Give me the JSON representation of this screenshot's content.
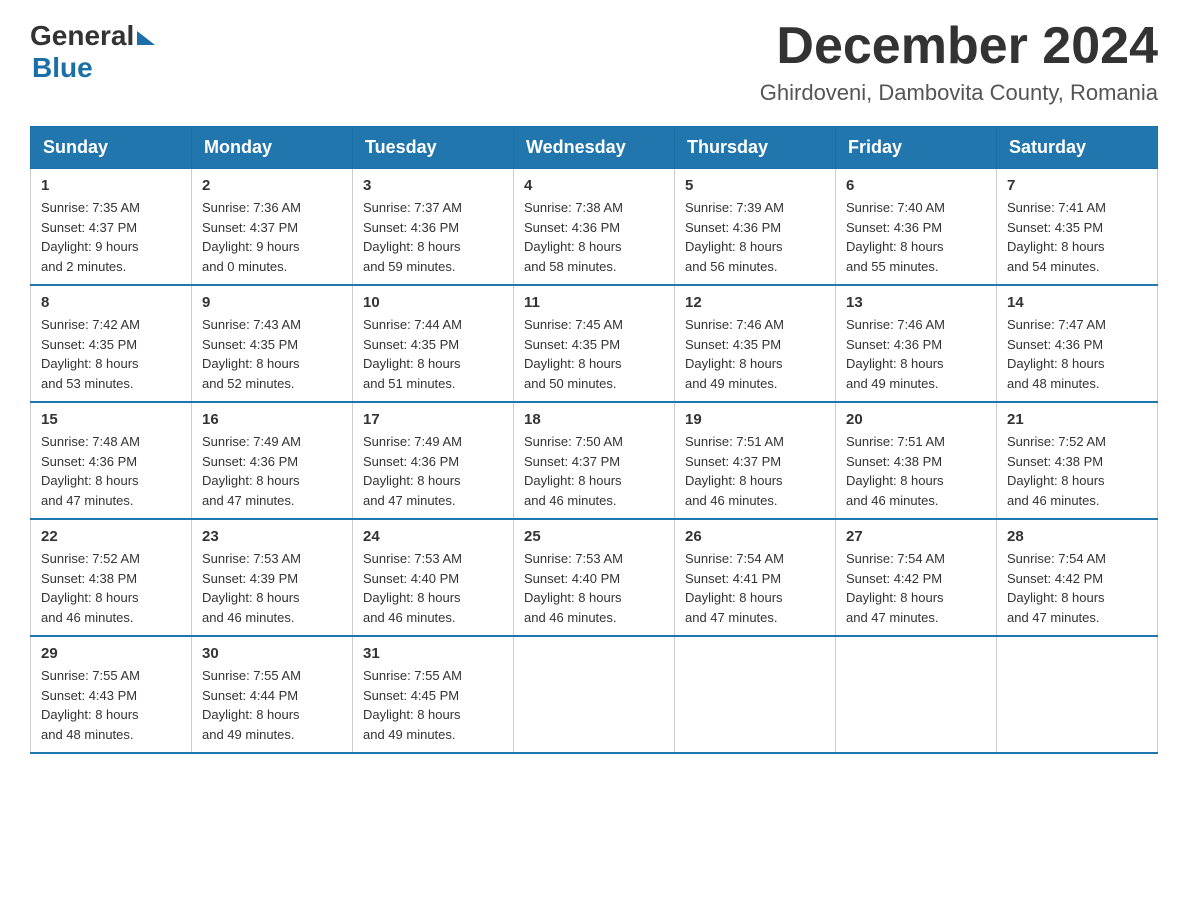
{
  "logo": {
    "general": "General",
    "blue": "Blue"
  },
  "header": {
    "title": "December 2024",
    "location": "Ghirdoveni, Dambovita County, Romania"
  },
  "days_of_week": [
    "Sunday",
    "Monday",
    "Tuesday",
    "Wednesday",
    "Thursday",
    "Friday",
    "Saturday"
  ],
  "weeks": [
    [
      {
        "day": "1",
        "sunrise": "7:35 AM",
        "sunset": "4:37 PM",
        "daylight": "9 hours and 2 minutes."
      },
      {
        "day": "2",
        "sunrise": "7:36 AM",
        "sunset": "4:37 PM",
        "daylight": "9 hours and 0 minutes."
      },
      {
        "day": "3",
        "sunrise": "7:37 AM",
        "sunset": "4:36 PM",
        "daylight": "8 hours and 59 minutes."
      },
      {
        "day": "4",
        "sunrise": "7:38 AM",
        "sunset": "4:36 PM",
        "daylight": "8 hours and 58 minutes."
      },
      {
        "day": "5",
        "sunrise": "7:39 AM",
        "sunset": "4:36 PM",
        "daylight": "8 hours and 56 minutes."
      },
      {
        "day": "6",
        "sunrise": "7:40 AM",
        "sunset": "4:36 PM",
        "daylight": "8 hours and 55 minutes."
      },
      {
        "day": "7",
        "sunrise": "7:41 AM",
        "sunset": "4:35 PM",
        "daylight": "8 hours and 54 minutes."
      }
    ],
    [
      {
        "day": "8",
        "sunrise": "7:42 AM",
        "sunset": "4:35 PM",
        "daylight": "8 hours and 53 minutes."
      },
      {
        "day": "9",
        "sunrise": "7:43 AM",
        "sunset": "4:35 PM",
        "daylight": "8 hours and 52 minutes."
      },
      {
        "day": "10",
        "sunrise": "7:44 AM",
        "sunset": "4:35 PM",
        "daylight": "8 hours and 51 minutes."
      },
      {
        "day": "11",
        "sunrise": "7:45 AM",
        "sunset": "4:35 PM",
        "daylight": "8 hours and 50 minutes."
      },
      {
        "day": "12",
        "sunrise": "7:46 AM",
        "sunset": "4:35 PM",
        "daylight": "8 hours and 49 minutes."
      },
      {
        "day": "13",
        "sunrise": "7:46 AM",
        "sunset": "4:36 PM",
        "daylight": "8 hours and 49 minutes."
      },
      {
        "day": "14",
        "sunrise": "7:47 AM",
        "sunset": "4:36 PM",
        "daylight": "8 hours and 48 minutes."
      }
    ],
    [
      {
        "day": "15",
        "sunrise": "7:48 AM",
        "sunset": "4:36 PM",
        "daylight": "8 hours and 47 minutes."
      },
      {
        "day": "16",
        "sunrise": "7:49 AM",
        "sunset": "4:36 PM",
        "daylight": "8 hours and 47 minutes."
      },
      {
        "day": "17",
        "sunrise": "7:49 AM",
        "sunset": "4:36 PM",
        "daylight": "8 hours and 47 minutes."
      },
      {
        "day": "18",
        "sunrise": "7:50 AM",
        "sunset": "4:37 PM",
        "daylight": "8 hours and 46 minutes."
      },
      {
        "day": "19",
        "sunrise": "7:51 AM",
        "sunset": "4:37 PM",
        "daylight": "8 hours and 46 minutes."
      },
      {
        "day": "20",
        "sunrise": "7:51 AM",
        "sunset": "4:38 PM",
        "daylight": "8 hours and 46 minutes."
      },
      {
        "day": "21",
        "sunrise": "7:52 AM",
        "sunset": "4:38 PM",
        "daylight": "8 hours and 46 minutes."
      }
    ],
    [
      {
        "day": "22",
        "sunrise": "7:52 AM",
        "sunset": "4:38 PM",
        "daylight": "8 hours and 46 minutes."
      },
      {
        "day": "23",
        "sunrise": "7:53 AM",
        "sunset": "4:39 PM",
        "daylight": "8 hours and 46 minutes."
      },
      {
        "day": "24",
        "sunrise": "7:53 AM",
        "sunset": "4:40 PM",
        "daylight": "8 hours and 46 minutes."
      },
      {
        "day": "25",
        "sunrise": "7:53 AM",
        "sunset": "4:40 PM",
        "daylight": "8 hours and 46 minutes."
      },
      {
        "day": "26",
        "sunrise": "7:54 AM",
        "sunset": "4:41 PM",
        "daylight": "8 hours and 47 minutes."
      },
      {
        "day": "27",
        "sunrise": "7:54 AM",
        "sunset": "4:42 PM",
        "daylight": "8 hours and 47 minutes."
      },
      {
        "day": "28",
        "sunrise": "7:54 AM",
        "sunset": "4:42 PM",
        "daylight": "8 hours and 47 minutes."
      }
    ],
    [
      {
        "day": "29",
        "sunrise": "7:55 AM",
        "sunset": "4:43 PM",
        "daylight": "8 hours and 48 minutes."
      },
      {
        "day": "30",
        "sunrise": "7:55 AM",
        "sunset": "4:44 PM",
        "daylight": "8 hours and 49 minutes."
      },
      {
        "day": "31",
        "sunrise": "7:55 AM",
        "sunset": "4:45 PM",
        "daylight": "8 hours and 49 minutes."
      },
      null,
      null,
      null,
      null
    ]
  ],
  "labels": {
    "sunrise": "Sunrise:",
    "sunset": "Sunset:",
    "daylight": "Daylight:"
  }
}
